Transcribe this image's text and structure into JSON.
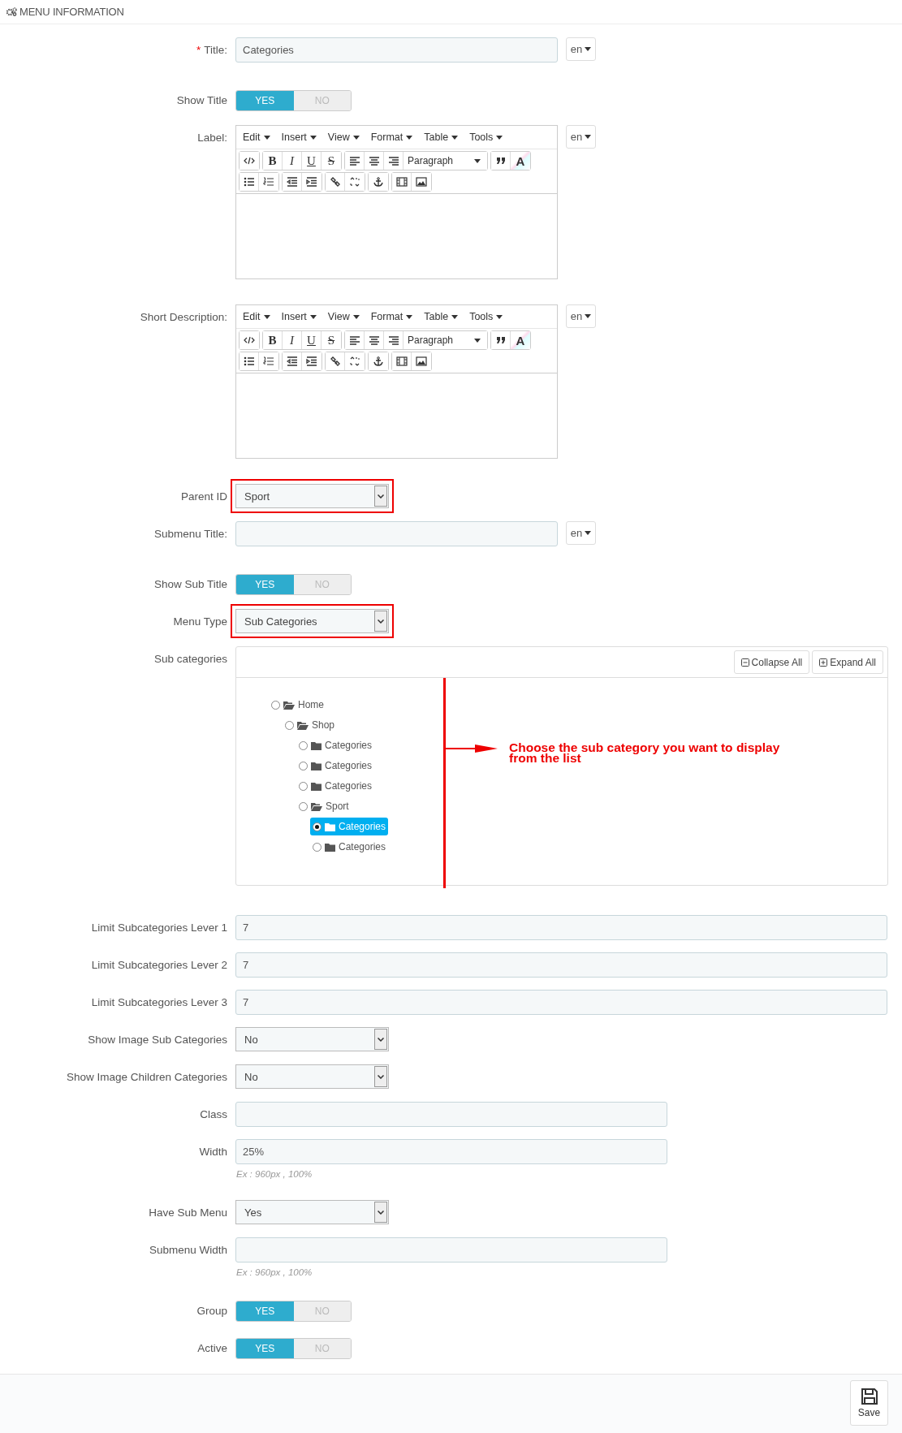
{
  "panel": {
    "title": "MENU INFORMATION"
  },
  "fields": [
    {
      "kind": "text",
      "label": "Title:",
      "required_mark": "*",
      "value": "Categories",
      "lang": "en"
    },
    {
      "kind": "toggle",
      "label": "Show Title",
      "options": [
        {
          "label": "YES",
          "selected": true
        },
        {
          "label": "NO",
          "selected": false
        }
      ]
    },
    {
      "kind": "editor",
      "label": "Label:",
      "lang": "en",
      "menus": [
        "Edit",
        "Insert",
        "View",
        "Format",
        "Table",
        "Tools"
      ],
      "letters": [
        "B",
        "I",
        "U",
        "S",
        "A"
      ],
      "block_format": "Paragraph"
    },
    {
      "kind": "editor",
      "label": "Short Description:",
      "lang": "en",
      "menus": [
        "Edit",
        "Insert",
        "View",
        "Format",
        "Table",
        "Tools"
      ],
      "letters": [
        "B",
        "I",
        "U",
        "S",
        "A"
      ],
      "block_format": "Paragraph"
    },
    {
      "kind": "select",
      "label": "Parent ID",
      "value": "Sport",
      "highlighted": true
    },
    {
      "kind": "text",
      "label": "Submenu Title:",
      "lang": "en"
    },
    {
      "kind": "toggle",
      "label": "Show Sub Title",
      "options": [
        {
          "label": "YES",
          "selected": true
        },
        {
          "label": "NO",
          "selected": false
        }
      ]
    },
    {
      "kind": "select",
      "label": "Menu Type",
      "value": "Sub Categories",
      "highlighted": true
    },
    {
      "kind": "tree",
      "label": "Sub categories",
      "buttons": [
        "Collapse All",
        "Expand All"
      ],
      "annotation": "Choose the sub category you want to display from the list",
      "nodes": [
        {
          "label": "Home",
          "selected": false,
          "expanded": true,
          "children": [
            {
              "label": "Shop",
              "selected": false,
              "expanded": true,
              "children": [
                {
                  "label": "Categories",
                  "selected": false,
                  "expanded": false
                },
                {
                  "label": "Categories",
                  "selected": false,
                  "expanded": false
                },
                {
                  "label": "Categories",
                  "selected": false,
                  "expanded": false
                },
                {
                  "label": "Sport",
                  "selected": false,
                  "expanded": true,
                  "children": [
                    {
                      "label": "Categories",
                      "selected": true,
                      "expanded": false
                    },
                    {
                      "label": "Categories",
                      "selected": false,
                      "expanded": false
                    }
                  ]
                }
              ]
            }
          ]
        }
      ]
    },
    {
      "kind": "number",
      "label": "Limit Subcategories Lever 1",
      "value": "7"
    },
    {
      "kind": "number",
      "label": "Limit Subcategories Lever 2",
      "value": "7"
    },
    {
      "kind": "number",
      "label": "Limit Subcategories Lever 3",
      "value": "7"
    },
    {
      "kind": "select",
      "label": "Show Image Sub Categories",
      "value": "No"
    },
    {
      "kind": "select",
      "label": "Show Image Children Categories",
      "value": "No"
    },
    {
      "kind": "text",
      "label": "Class"
    },
    {
      "kind": "text",
      "label": "Width",
      "value": "25%",
      "help": "Ex : 960px , 100%"
    },
    {
      "kind": "select",
      "label": "Have Sub Menu",
      "value": "Yes"
    },
    {
      "kind": "text",
      "label": "Submenu Width",
      "help": "Ex : 960px , 100%"
    },
    {
      "kind": "toggle",
      "label": "Group",
      "options": [
        {
          "label": "YES",
          "selected": true
        },
        {
          "label": "NO",
          "selected": false
        }
      ]
    },
    {
      "kind": "toggle",
      "label": "Active",
      "options": [
        {
          "label": "YES",
          "selected": true
        },
        {
          "label": "NO",
          "selected": false
        }
      ]
    }
  ],
  "footer": {
    "save": "Save"
  }
}
